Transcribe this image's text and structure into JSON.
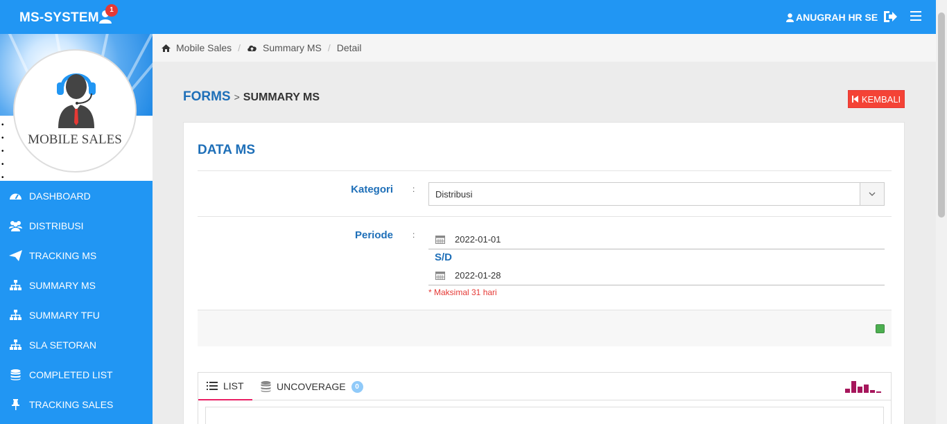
{
  "topbar": {
    "brand": "MS-SYSTEM",
    "notification_count": "1",
    "user_name": "ANUGRAH HR SE"
  },
  "sidebar": {
    "profile_label": "MOBILE SALES",
    "items": [
      {
        "label": "DASHBOARD",
        "icon": "dashboard-icon"
      },
      {
        "label": "DISTRIBUSI",
        "icon": "users-icon"
      },
      {
        "label": "TRACKING MS",
        "icon": "paper-plane-icon"
      },
      {
        "label": "SUMMARY MS",
        "icon": "sitemap-icon"
      },
      {
        "label": "SUMMARY TFU",
        "icon": "sitemap-icon"
      },
      {
        "label": "SLA SETORAN",
        "icon": "sitemap-icon"
      },
      {
        "label": "COMPLETED LIST",
        "icon": "database-icon"
      },
      {
        "label": "TRACKING SALES",
        "icon": "pin-icon"
      }
    ]
  },
  "breadcrumb": {
    "items": [
      "Mobile Sales",
      "Summary MS",
      "Detail"
    ]
  },
  "header": {
    "forms": "FORMS",
    "separator": ">",
    "title": "SUMMARY MS",
    "back_button": "KEMBALI"
  },
  "card": {
    "title": "DATA MS",
    "kategori_label": "Kategori",
    "colon": ":",
    "kategori_value": "Distribusi",
    "periode_label": "Periode",
    "date_from": "2022-01-01",
    "sd_label": "S/D",
    "date_to": "2022-01-28",
    "hint": "* Maksimal 31 hari"
  },
  "tabs": {
    "list_label": "LIST",
    "uncoverage_label": "UNCOVERAGE",
    "uncoverage_count": "0"
  },
  "colors": {
    "primary": "#2196f3",
    "title_blue": "#1e6fb8",
    "danger": "#f44336",
    "accent_tab": "#e91e63",
    "success": "#4caf50"
  }
}
